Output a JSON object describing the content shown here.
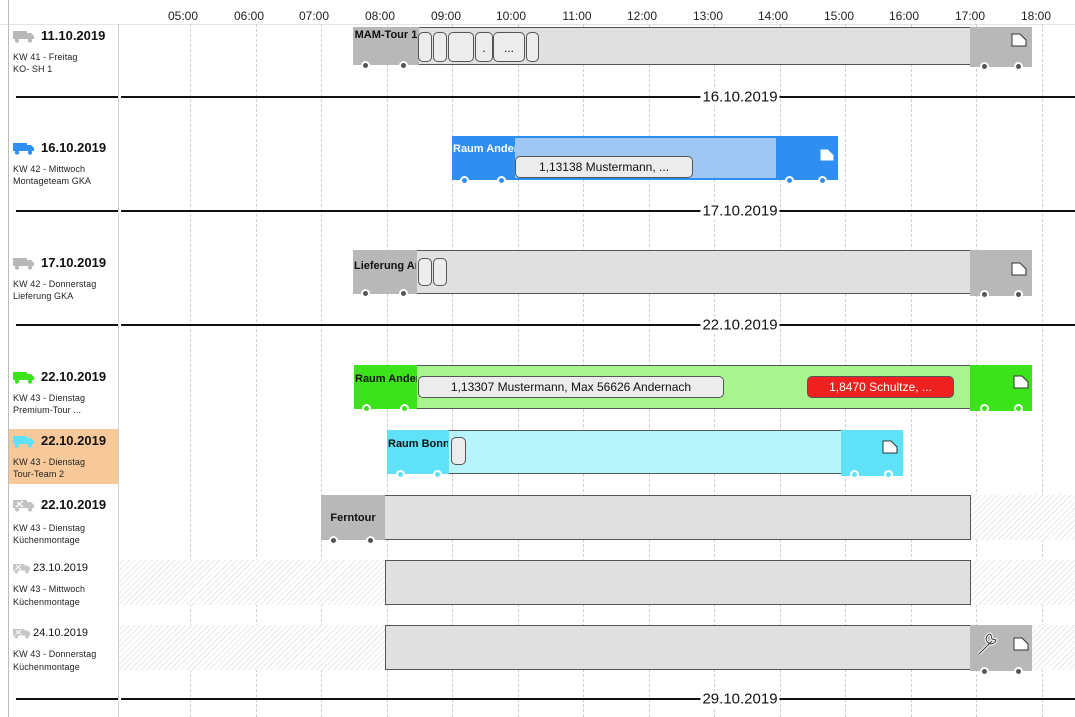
{
  "timeline": {
    "hours": [
      "05:00",
      "06:00",
      "07:00",
      "08:00",
      "09:00",
      "10:00",
      "11:00",
      "12:00",
      "13:00",
      "14:00",
      "15:00",
      "16:00",
      "17:00",
      "18:00"
    ]
  },
  "colors": {
    "grey_truck": "#b8b8b8",
    "blue_truck": "#2f8ff0",
    "blue_body": "#9fc7f3",
    "green_truck": "#3be31a",
    "green_body": "#a8f58f",
    "cyan_truck": "#5fe2f8",
    "cyan_body": "#b8f4fb",
    "body_grey": "#e0e0e0",
    "row_highlight": "#f7c99a"
  },
  "rows": [
    {
      "date": "11.10.2019",
      "line2": "KW 41 - Freitag",
      "line3": "KO- SH 1",
      "icon": "truck-icon"
    },
    {
      "date": "16.10.2019",
      "line2": "KW 42 - Mittwoch",
      "line3": "Montageteam GKA",
      "icon": "truck-icon"
    },
    {
      "date": "17.10.2019",
      "line2": "KW 42 - Donnerstag",
      "line3": "Lieferung GKA",
      "icon": "truck-icon"
    },
    {
      "date": "22.10.2019",
      "line2": "KW 43 - Dienstag",
      "line3": "Premium-Tour ...",
      "icon": "truck-icon"
    },
    {
      "date": "22.10.2019",
      "line2": "KW 43 - Dienstag",
      "line3": "Tour-Team 2",
      "icon": "truck-icon"
    },
    {
      "date": "22.10.2019",
      "line2": "KW 43 - Dienstag",
      "line3": "Küchenmontage",
      "icon": "tools-truck-icon"
    },
    {
      "date": "23.10.2019",
      "line2": "KW 43 - Mittwoch",
      "line3": "Küchenmontage",
      "icon": "tools-truck-icon"
    },
    {
      "date": "24.10.2019",
      "line2": "KW 43 - Donnerstag",
      "line3": "Küchenmontage",
      "icon": "tools-truck-icon"
    }
  ],
  "separators": [
    "16.10.2019",
    "17.10.2019",
    "22.10.2019",
    "29.10.2019"
  ],
  "tours": {
    "t1": {
      "label": "MAM-Tour 1",
      "pills": [
        "",
        "",
        "",
        ".",
        "..."
      ]
    },
    "t2": {
      "label": "Raum Andernach",
      "pills": [
        "1,13138 Mustermann, ..."
      ]
    },
    "t3": {
      "label": "Lieferung Andernach",
      "pills": [
        "",
        ""
      ]
    },
    "t4": {
      "label": "Raum Andernach",
      "pills": [
        "1,13307 Mustermann, Max 56626 Andernach",
        "1,8470 Schultze, ..."
      ]
    },
    "t5": {
      "label": "Raum Bonn",
      "pills": [
        ""
      ]
    },
    "t6": {
      "label": "Ferntour",
      "pills": []
    }
  }
}
